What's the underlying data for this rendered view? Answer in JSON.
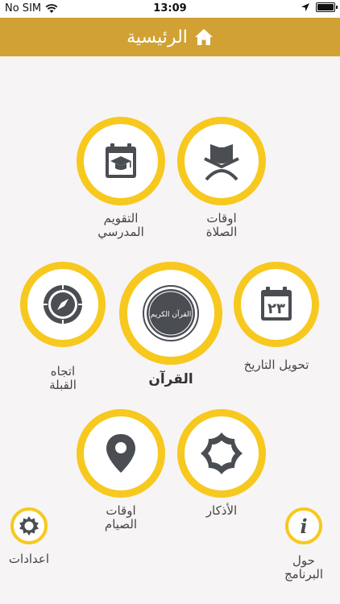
{
  "status_bar": {
    "carrier": "No SIM",
    "time": "13:09"
  },
  "header": {
    "title": "الرئيسية"
  },
  "menu": {
    "prayer_times": "اوقات\nالصلاة",
    "school_calendar": "التقويم\nالمدرسي",
    "date_conversion": "تحويل التاريخ",
    "quran": "القرآن",
    "qibla": "اتجاه\nالقبلة",
    "adhkar": "الأذكار",
    "fasting_times": "اوقات\nالصيام",
    "settings": "اعدادات",
    "about": "حول\nالبرنامج"
  },
  "icons": {
    "prayer_times": "quran-stand-icon",
    "school_calendar": "graduation-calendar-icon",
    "date_conversion": "calendar-23-icon",
    "quran": "quran-calligraphy-icon",
    "qibla": "compass-icon",
    "adhkar": "ornament-frame-icon",
    "fasting_times": "location-pin-icon",
    "settings": "gear-icon",
    "about": "info-icon"
  },
  "calendar_day": "٢٣",
  "quran_glyph": "القرآن الكريم",
  "about_glyph": "i",
  "colors": {
    "header": "#d1a233",
    "ring": "#f7c81e",
    "icon": "#4a4d52",
    "background": "#f7f4f5"
  }
}
